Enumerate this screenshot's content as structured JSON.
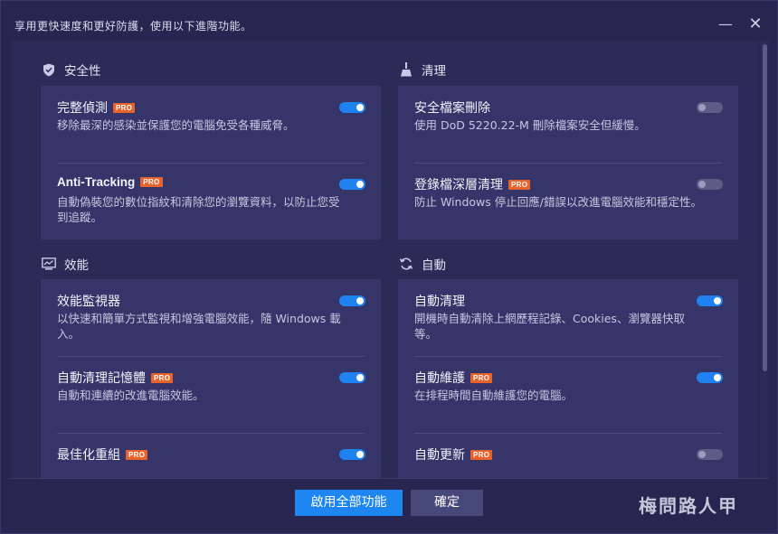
{
  "window": {
    "title": "享用更快速度和更好防護，使用以下進階功能。",
    "minimize_glyph": "—",
    "close_glyph": "✕"
  },
  "sections": {
    "security": {
      "label": "安全性",
      "icon": "shield-icon",
      "items": [
        {
          "title": "完整偵測",
          "pro": "PRO",
          "desc": "移除最深的感染並保護您的電腦免受各種威脅。",
          "enabled": true
        },
        {
          "title": "Anti-Tracking",
          "pro": "PRO",
          "desc": "自動偽裝您的數位指紋和清除您的瀏覽資料，以防止您受到追蹤。",
          "enabled": true
        }
      ]
    },
    "cleanup": {
      "label": "清理",
      "icon": "broom-icon",
      "items": [
        {
          "title": "安全檔案刪除",
          "pro": "",
          "desc": "使用 DoD 5220.22-M 刪除檔案安全但緩慢。",
          "enabled": false
        },
        {
          "title": "登錄檔深層清理",
          "pro": "PRO",
          "desc": "防止 Windows 停止回應/錯誤以改進電腦效能和穩定性。",
          "enabled": false
        }
      ]
    },
    "performance": {
      "label": "效能",
      "icon": "monitor-icon",
      "items": [
        {
          "title": "效能監視器",
          "pro": "",
          "desc": "以快速和簡單方式監視和增強電腦效能，隨 Windows 載入。",
          "enabled": true
        },
        {
          "title": "自動清理記憶體",
          "pro": "PRO",
          "desc": "自動和連續的改進電腦效能。",
          "enabled": true
        },
        {
          "title": "最佳化重組",
          "pro": "PRO",
          "desc": "",
          "enabled": true
        }
      ]
    },
    "auto": {
      "label": "自動",
      "icon": "refresh-icon",
      "items": [
        {
          "title": "自動清理",
          "pro": "",
          "desc": "開機時自動清除上網歷程記錄、Cookies、瀏覽器快取等。",
          "enabled": true
        },
        {
          "title": "自動維護",
          "pro": "PRO",
          "desc": "在排程時間自動維護您的電腦。",
          "enabled": true
        },
        {
          "title": "自動更新",
          "pro": "PRO",
          "desc": "",
          "enabled": false
        }
      ]
    }
  },
  "footer": {
    "enable_all_label": "啟用全部功能",
    "confirm_label": "確定"
  },
  "watermark": "梅問路人甲",
  "colors": {
    "accent": "#1e86f0",
    "pro_badge": "#e8632b",
    "card": "#35356a",
    "background": "#262650"
  }
}
